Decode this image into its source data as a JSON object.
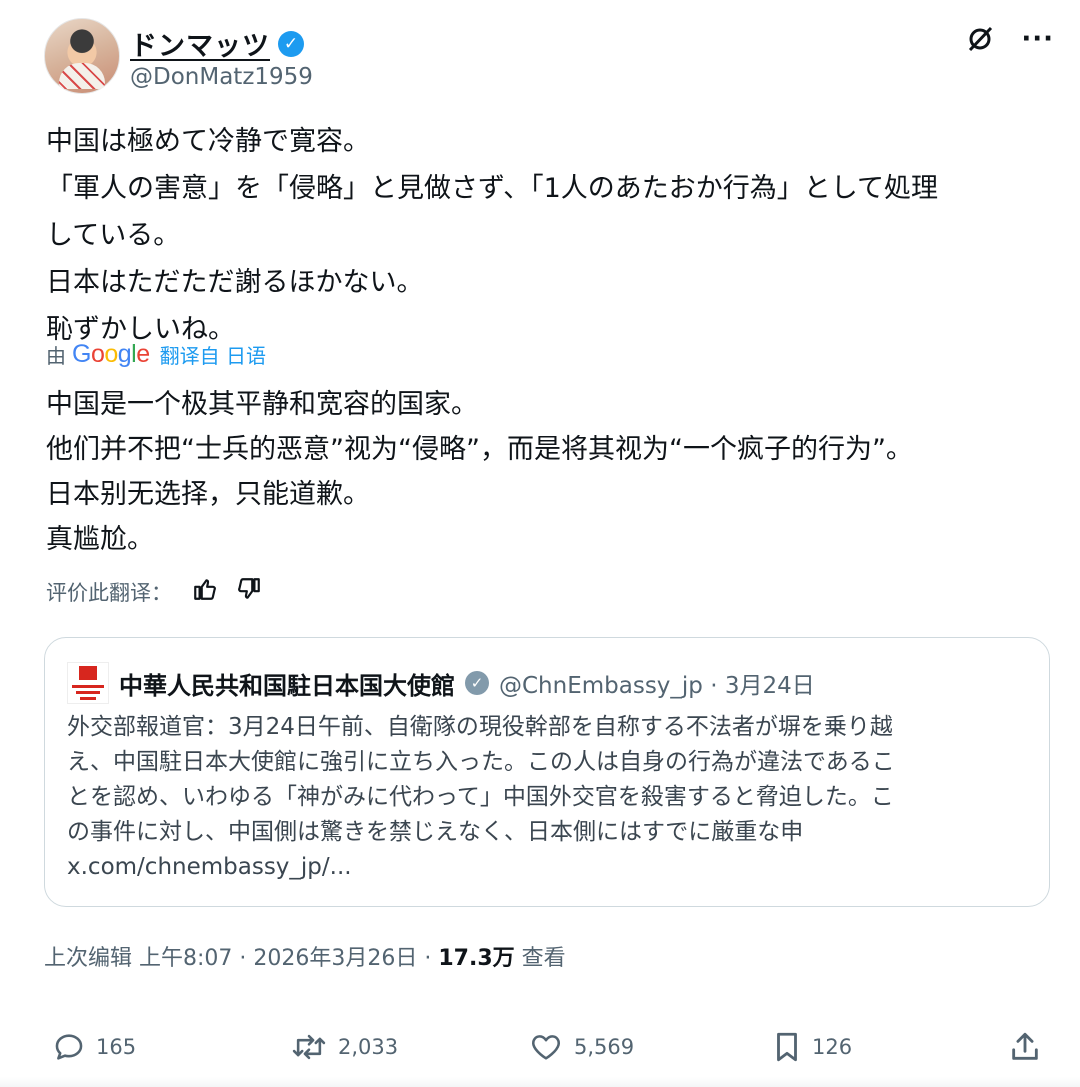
{
  "author": {
    "display_name": "ドンマッツ",
    "handle": "@DonMatz1959",
    "verified_mark": "✓"
  },
  "header_icons": [
    "grok-slash-icon",
    "more-icon"
  ],
  "more_label": "···",
  "tweet_lines": [
    "中国は極めて冷静で寛容。",
    "「軍人の害意」を「侵略」と見做さず、「1人のあたおか行為」として処理",
    "している。",
    "日本はただただ謝るほかない。",
    "恥ずかしいね。"
  ],
  "translation": {
    "by": "由",
    "engine": "Google",
    "link": "翻译自 日语",
    "lines": [
      "中国是一个极其平静和宽容的国家。",
      "他们并不把“士兵的恶意”视为“侵略”，而是将其视为“一个疯子的行为”。",
      "日本别无选择，只能道歉。",
      "真尴尬。"
    ],
    "rate_label": "评价此翻译："
  },
  "quote": {
    "name": "中華人民共和国駐日本国大使館",
    "verified_mark": "✓",
    "handle_date": "@ChnEmbassy_jp · 3月24日",
    "lines": [
      "外交部報道官：3月24日午前、自衛隊の現役幹部を自称する不法者が塀を乗り越",
      "え、中国駐日本大使館に強引に立ち入った。この人は自身の行為が違法であるこ",
      "とを認め、いわゆる「神がみに代わって」中国外交官を殺害すると脅迫した。こ",
      "の事件に対し、中国側は驚きを禁じえなく、日本側にはすでに厳重な申",
      "x.com/chnembassy_jp/..."
    ]
  },
  "meta": {
    "edited": "上次编辑",
    "time_date": "上午8:07 · 2026年3月26日 ·",
    "views_count": "17.3万",
    "views_label": "查看"
  },
  "actions": {
    "replies": "165",
    "reposts": "2,033",
    "likes": "5,569",
    "bookmarks": "126"
  }
}
